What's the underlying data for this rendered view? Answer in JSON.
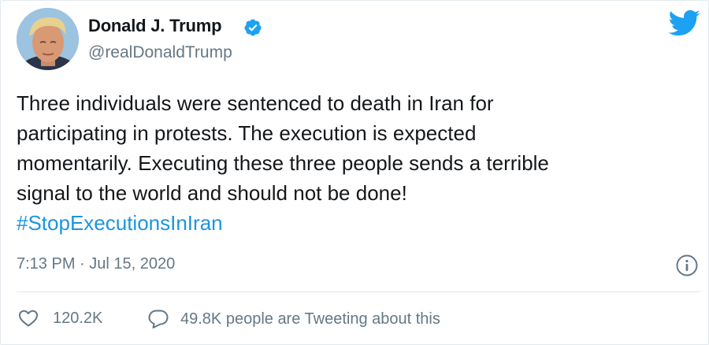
{
  "author": {
    "display_name": "Donald J. Trump",
    "handle": "@realDonaldTrump",
    "verified": true
  },
  "tweet": {
    "lines": [
      "Three individuals were sentenced to death in Iran for",
      "participating in protests. The execution is expected",
      "momentarily. Executing these three people sends a terrible",
      "signal to the world and should not be done!"
    ],
    "hashtag": "#StopExecutionsInIran",
    "timestamp": "7:13 PM · Jul 15, 2020"
  },
  "actions": {
    "like_count": "120.2K",
    "reply_text": "49.8K people are Tweeting about this"
  },
  "colors": {
    "link": "#1b95e0",
    "secondary_text": "#657786",
    "twitter_blue": "#1da1f2",
    "border": "#e1e8ed"
  },
  "icons": [
    "verified-badge-icon",
    "twitter-bird-icon",
    "info-icon",
    "heart-icon",
    "speech-bubble-icon"
  ]
}
